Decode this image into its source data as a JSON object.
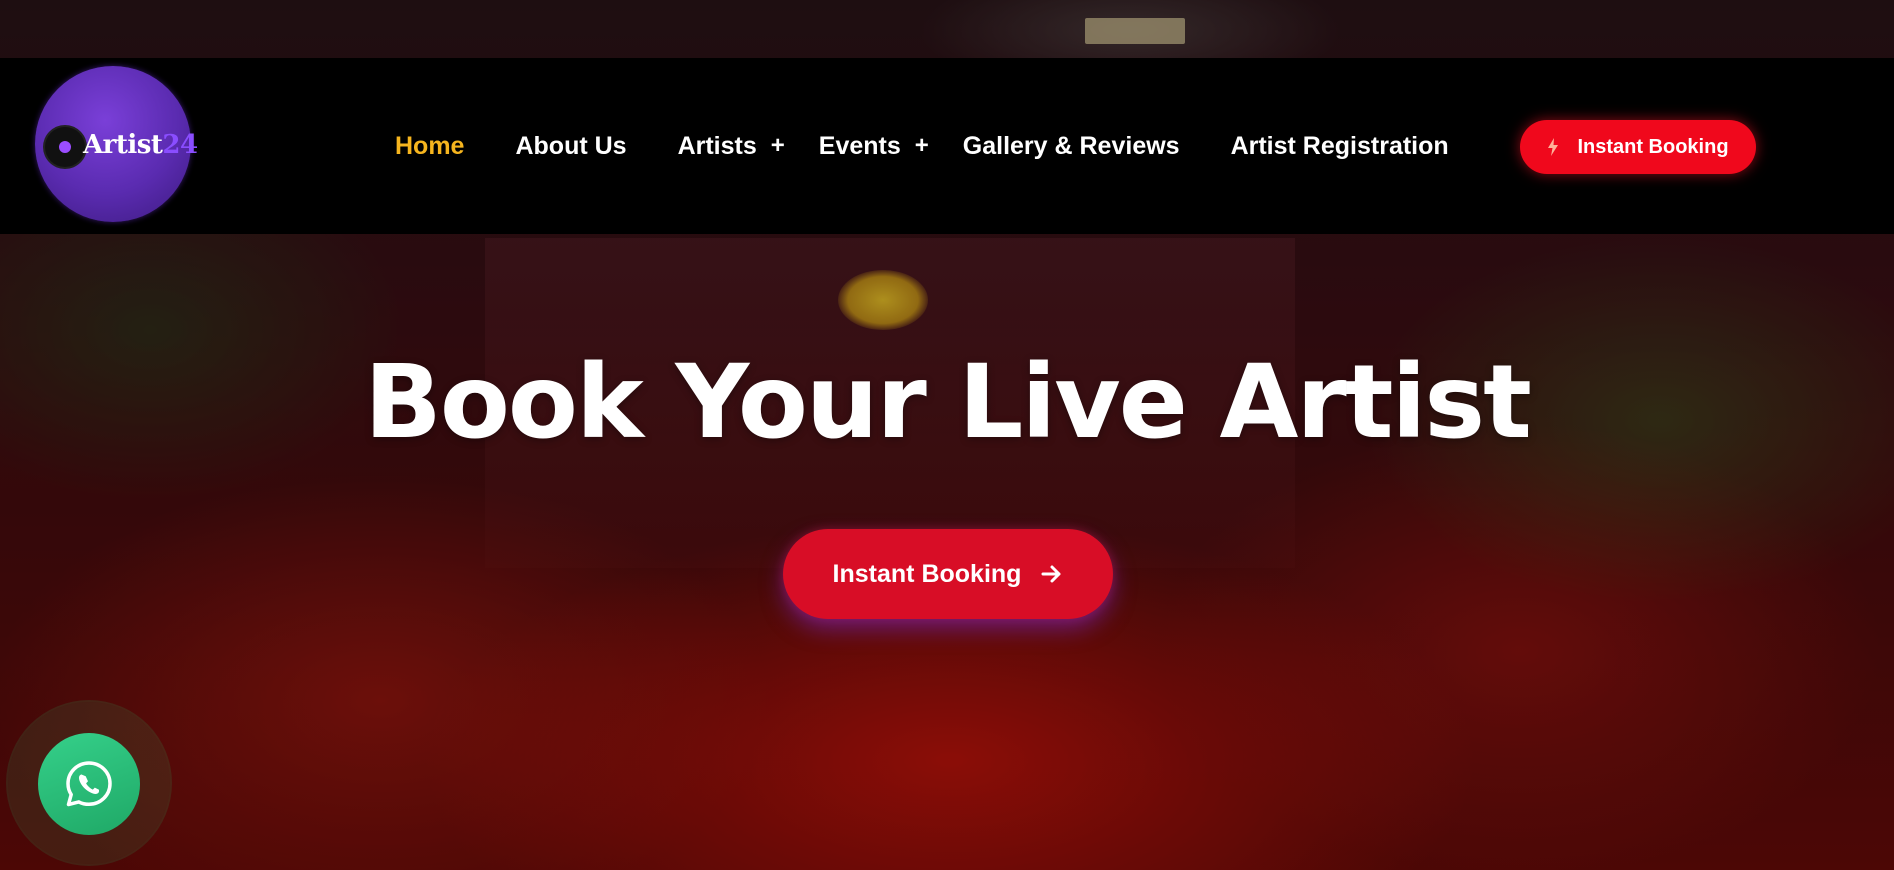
{
  "brand": {
    "logo_text": "Artist",
    "logo_number": "24"
  },
  "nav": {
    "items": [
      {
        "label": "Home",
        "active": true,
        "has_submenu": false
      },
      {
        "label": "About Us",
        "active": false,
        "has_submenu": false
      },
      {
        "label": "Artists",
        "active": false,
        "has_submenu": true
      },
      {
        "label": "Events",
        "active": false,
        "has_submenu": true
      },
      {
        "label": "Gallery & Reviews",
        "active": false,
        "has_submenu": false
      },
      {
        "label": "Artist Registration",
        "active": false,
        "has_submenu": false
      }
    ],
    "submenu_symbol": "+",
    "cta_label": "Instant Booking",
    "cta_icon": "lightning-bolt-icon"
  },
  "hero": {
    "title": "Book Your Live Artist",
    "cta_label": "Instant Booking",
    "cta_icon": "arrow-right-icon"
  },
  "floating": {
    "whatsapp_icon": "whatsapp-icon"
  },
  "colors": {
    "active_nav": "#f6b51e",
    "cta_header": "#f0081c",
    "cta_hero": "#d80d26",
    "brand_purple": "#5a2bb0",
    "whatsapp_green": "#25c27a"
  }
}
